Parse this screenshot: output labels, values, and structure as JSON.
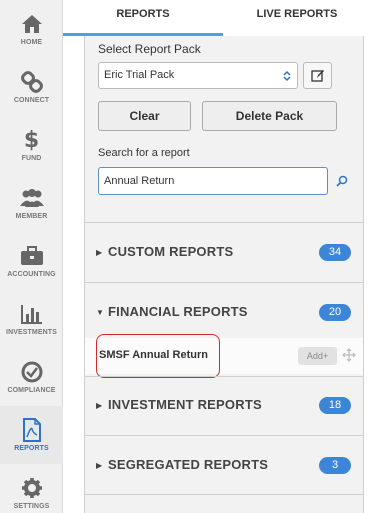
{
  "nav": {
    "items": [
      {
        "label": "HOME",
        "icon": "home-icon"
      },
      {
        "label": "CONNECT",
        "icon": "link-icon"
      },
      {
        "label": "FUND",
        "icon": "dollar-icon"
      },
      {
        "label": "MEMBER",
        "icon": "members-icon"
      },
      {
        "label": "ACCOUNTING",
        "icon": "briefcase-icon"
      },
      {
        "label": "INVESTMENTS",
        "icon": "bar-chart-icon"
      },
      {
        "label": "COMPLIANCE",
        "icon": "check-circle-icon"
      },
      {
        "label": "REPORTS",
        "icon": "report-document-icon"
      },
      {
        "label": "SETTINGS",
        "icon": "gear-icon"
      }
    ],
    "active": "REPORTS"
  },
  "tabs": {
    "reports": "REPORTS",
    "live_reports": "LIVE REPORTS"
  },
  "pack": {
    "label": "Select Report Pack",
    "selected": "Eric Trial Pack"
  },
  "buttons": {
    "clear": "Clear",
    "delete_pack": "Delete Pack",
    "add": "Add+"
  },
  "search": {
    "label": "Search for a report",
    "value": "Annual Return"
  },
  "sections": [
    {
      "title": "CUSTOM REPORTS",
      "count": "34",
      "expanded": false
    },
    {
      "title": "FINANCIAL REPORTS",
      "count": "20",
      "expanded": true
    },
    {
      "title": "INVESTMENT REPORTS",
      "count": "18",
      "expanded": false
    },
    {
      "title": "SEGREGATED REPORTS",
      "count": "3",
      "expanded": false
    }
  ],
  "report_item": "SMSF Annual Return",
  "colors": {
    "accent": "#3d86d7",
    "tab_underline": "#4aa3df",
    "highlight": "#d42a2a"
  }
}
